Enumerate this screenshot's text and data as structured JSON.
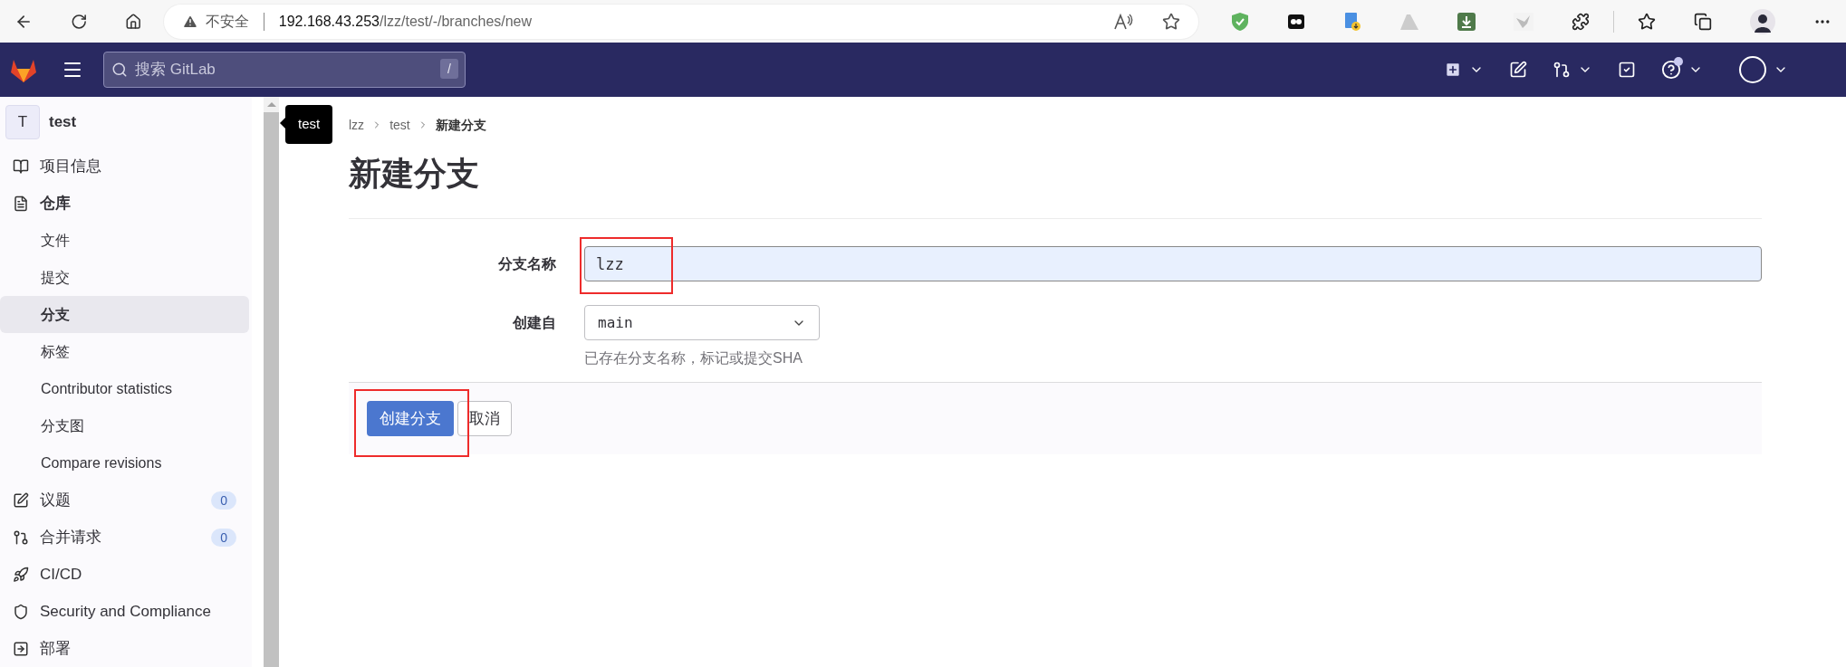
{
  "browser": {
    "security_label": "不安全",
    "url_host": "192.168.43.253",
    "url_path": "/lzz/test/-/branches/new"
  },
  "topbar": {
    "search_placeholder": "搜索 GitLab",
    "search_shortcut": "/",
    "help_badge": true
  },
  "sidebar": {
    "project_initial": "T",
    "project_name": "test",
    "items": [
      {
        "label": "项目信息",
        "expanded": false,
        "selected": false
      },
      {
        "label": "仓库",
        "expanded": true,
        "selected": false,
        "children": [
          {
            "label": "文件",
            "selected": false
          },
          {
            "label": "提交",
            "selected": false
          },
          {
            "label": "分支",
            "selected": true
          },
          {
            "label": "标签",
            "selected": false
          },
          {
            "label": "Contributor statistics",
            "selected": false
          },
          {
            "label": "分支图",
            "selected": false
          },
          {
            "label": "Compare revisions",
            "selected": false
          }
        ]
      },
      {
        "label": "议题",
        "count": "0",
        "expanded": false,
        "selected": false
      },
      {
        "label": "合并请求",
        "count": "0",
        "expanded": false,
        "selected": false
      },
      {
        "label": "CI/CD",
        "expanded": false,
        "selected": false
      },
      {
        "label": "Security and Compliance",
        "expanded": false,
        "selected": false
      },
      {
        "label": "部署",
        "expanded": false,
        "selected": false
      }
    ]
  },
  "tooltip": "test",
  "breadcrumbs": [
    "lzz",
    "test",
    "新建分支"
  ],
  "title": "新建分支",
  "form": {
    "branch_name": {
      "label": "分支名称",
      "value": "lzz"
    },
    "create_from": {
      "label": "创建自",
      "value": "main",
      "help": "已存在分支名称，标记或提交SHA"
    }
  },
  "buttons": {
    "submit": "创建分支",
    "cancel": "取消"
  }
}
